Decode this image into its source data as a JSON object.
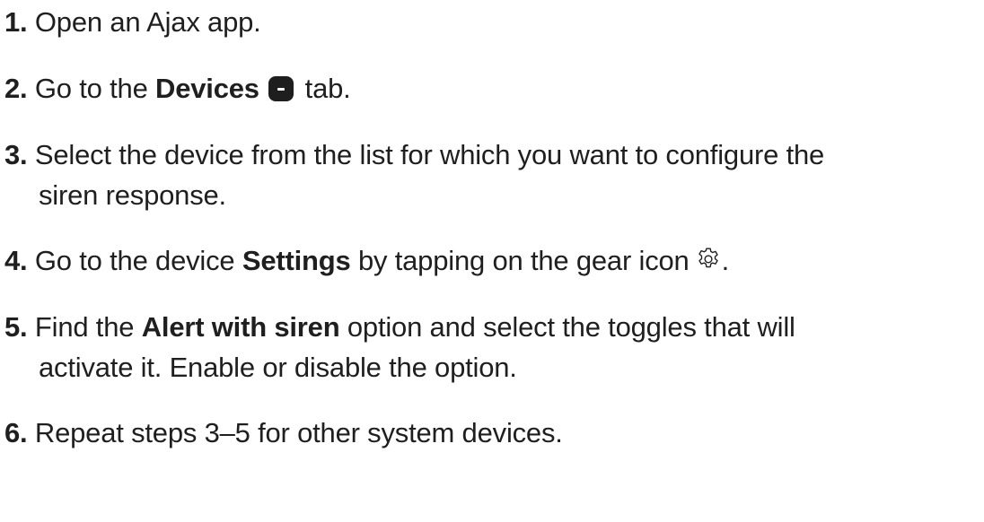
{
  "steps": [
    {
      "number": "1.",
      "t1": "Open an Ajax app."
    },
    {
      "number": "2.",
      "t1": "Go to the ",
      "bold": "Devices",
      "icon": "devices-tab-icon",
      "t2": " tab."
    },
    {
      "number": "3.",
      "t1": "Select the device from the list for which you want to configure the",
      "t2": "siren response."
    },
    {
      "number": "4.",
      "t1": "Go to the device ",
      "bold": "Settings",
      "t2": " by tapping on the gear icon",
      "icon": "gear-icon",
      "t3": "."
    },
    {
      "number": "5.",
      "t1": "Find the ",
      "bold": "Alert with siren",
      "t2": " option and select the toggles that will",
      "t3": "activate it. Enable or disable the option."
    },
    {
      "number": "6.",
      "t1": "Repeat steps 3–5 for other system devices."
    }
  ],
  "colors": {
    "text": "#1f1f1f",
    "icon_fill": "#1e1e1e",
    "background": "#ffffff"
  }
}
